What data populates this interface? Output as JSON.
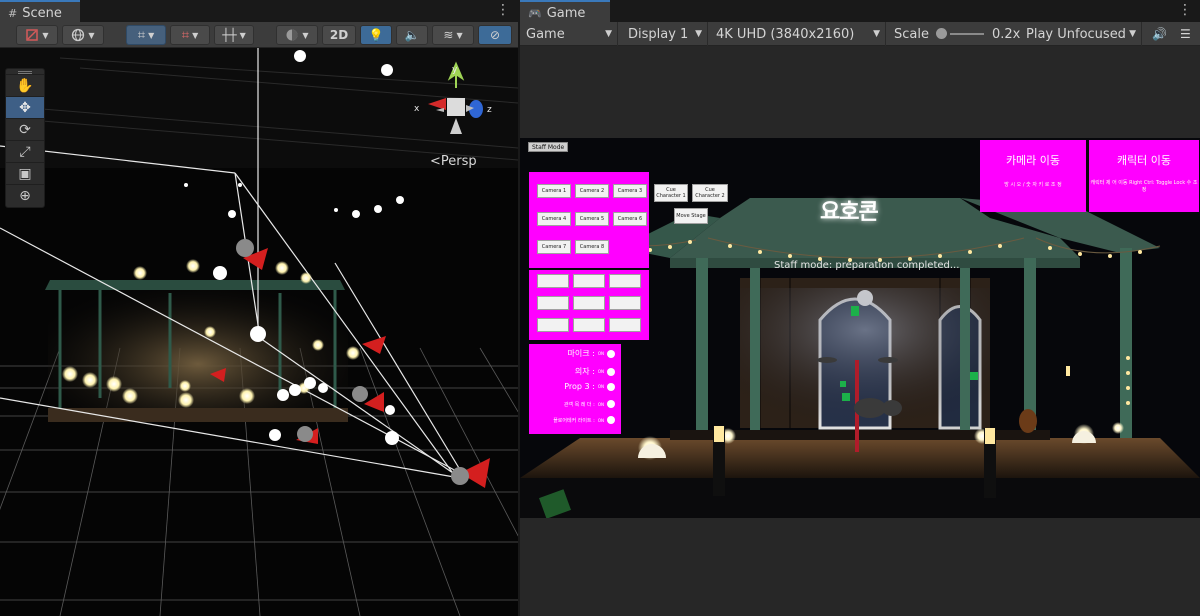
{
  "scene": {
    "tab_title": "Scene",
    "toolbar": {
      "mode_2d": "2D"
    },
    "tools": [
      "hand",
      "move",
      "rotate",
      "scale",
      "rect",
      "transform"
    ],
    "gizmo": {
      "axis_x": "x",
      "axis_y": "y",
      "axis_z": "z"
    },
    "projection_label": "<Persp"
  },
  "game": {
    "tab_title": "Game",
    "toolbar": {
      "view": "Game",
      "display": "Display 1",
      "resolution": "4K UHD (3840x2160)",
      "scale_label": "Scale",
      "scale_value": "0.2x",
      "play_mode": "Play Unfocused"
    },
    "hud": {
      "staff_button": "Staff Mode",
      "status_text": "Staff mode: preparation completed...",
      "logo_text": "요호콘",
      "camera_buttons": [
        "Camera 1",
        "Camera 2",
        "Camera 3",
        "Camera 4",
        "Camera 5",
        "Camera 6",
        "Camera 7",
        "Camera 8"
      ],
      "cue_buttons": [
        "Cue Character 1",
        "Cue Character 2",
        "Move Stage"
      ],
      "toggles": [
        {
          "label": "마이크 :",
          "state": "ON"
        },
        {
          "label": "의자 :",
          "state": "ON"
        },
        {
          "label": "Prop 3 :",
          "state": "ON"
        },
        {
          "label": "관객 목 레 더 :",
          "state": "ON"
        },
        {
          "label": "플로어테커 라이트 :",
          "state": "ON"
        }
      ],
      "camera_move": {
        "title": "카메라 이동",
        "subtitle": "방 시 오 / 숫 자 키 로 조 정"
      },
      "character_move": {
        "title": "캐릭터 이동",
        "subtitle": "캐릭터 제 어 이동 Right Ctrl: Toggle Lock 수 조정"
      }
    }
  }
}
